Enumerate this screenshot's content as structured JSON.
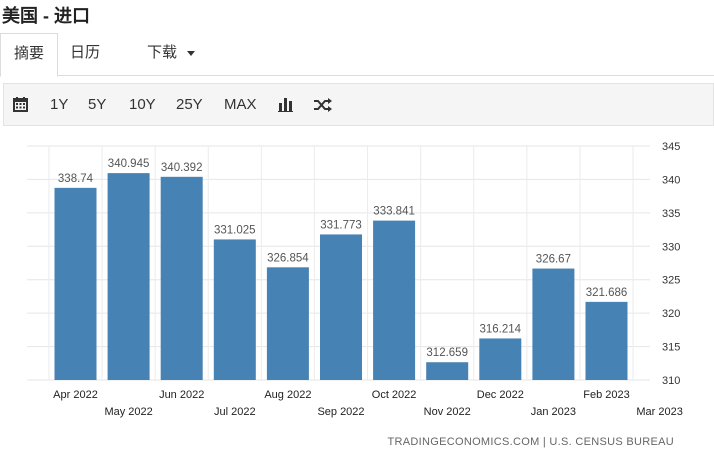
{
  "page": {
    "title": "美国 - 进口"
  },
  "tabs": [
    {
      "label": "摘要",
      "active": true
    },
    {
      "label": "日历",
      "active": false
    },
    {
      "label": "下载",
      "active": false
    }
  ],
  "toolbar": {
    "ranges": [
      "1Y",
      "5Y",
      "10Y",
      "25Y",
      "MAX"
    ],
    "icons": [
      "calendar-icon",
      "bar-chart-icon",
      "shuffle-icon"
    ]
  },
  "chart_data": {
    "type": "bar",
    "categories": [
      "Apr 2022",
      "May 2022",
      "Jun 2022",
      "Jul 2022",
      "Aug 2022",
      "Sep 2022",
      "Oct 2022",
      "Nov 2022",
      "Dec 2022",
      "Jan 2023",
      "Feb 2023",
      "Mar 2023"
    ],
    "values": [
      338.74,
      340.945,
      340.392,
      331.025,
      326.854,
      331.773,
      333.841,
      312.659,
      316.214,
      326.67,
      321.686,
      null
    ],
    "value_labels": [
      "338.74",
      "340.945",
      "340.392",
      "331.025",
      "326.854",
      "331.773",
      "333.841",
      "312.659",
      "316.214",
      "326.67",
      "321.686",
      ""
    ],
    "ylim": [
      310,
      345
    ],
    "yticks": [
      310,
      315,
      320,
      325,
      330,
      335,
      340,
      345
    ],
    "y_axis_side": "right",
    "grid": true,
    "bar_color": "#4682b4"
  },
  "source": "TRADINGECONOMICS.COM | U.S. CENSUS BUREAU"
}
